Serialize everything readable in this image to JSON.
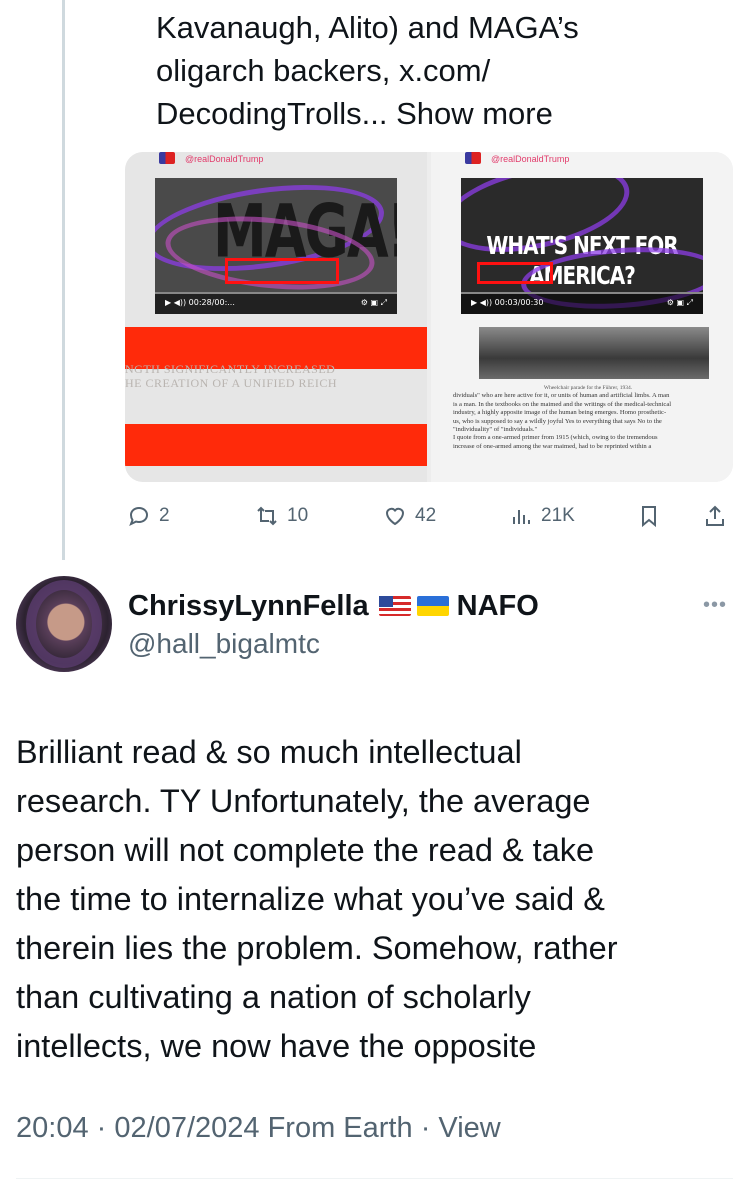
{
  "quoted_tweet": {
    "text_lines": [
      "Kavanaugh, Alito) and MAGA’s",
      "oligarch backers, x.com/",
      "DecodingTrolls..."
    ],
    "show_more": "Show more",
    "media": {
      "left": {
        "handle": "@realDonaldTrump",
        "headline": "MAGA!!",
        "video_time": "00:28/00:...",
        "caption_lines": [
          "NGTH SIGNIFICANTLY INCREASED",
          "HE CREATION OF A UNIFIED REICH"
        ]
      },
      "right": {
        "handle": "@realDonaldTrump",
        "headline": "WHAT'S NEXT FOR AMERICA?",
        "video_time": "00:03/00:30",
        "photo_caption": "Wheelchair parade for the Führer, 1934.",
        "book_lines": [
          "dividuals\" who are here active for it, or units of human and artificial limbs. A man",
          "is a man. In the textbooks on the maimed and the writings of the medical-technical",
          "industry, a highly apposite image of the human being emerges. Homo prosthetic-",
          "us, who is supposed to say a wildly joyful Yes to everything that says No to the",
          "\"individuality\" of \"individuals.\"",
          "I quote from a one-armed primer from 1915 (which, owing to the tremendous",
          "increase of one-armed among the war maimed, had to be reprinted within a"
        ]
      }
    },
    "actions": {
      "replies": "2",
      "reposts": "10",
      "likes": "42",
      "views": "21K"
    }
  },
  "reply": {
    "display_name": "ChrissyLynnFella",
    "name_suffix": "NAFO",
    "handle": "@hall_bigalmtc",
    "body": "Brilliant read & so much intellectual\nresearch.  TY Unfortunately, the average\nperson will not complete the read & take\nthe time to internalize what you’ve said &\ntherein lies the problem. Somehow, rather\nthan cultivating a nation of scholarly\nintellects, we now have the opposite",
    "time": "20:04",
    "date": "02/07/2024",
    "source": "From Earth",
    "view_link": "View",
    "separator": "·"
  },
  "colors": {
    "text_primary": "#0f1419",
    "text_secondary": "#536471",
    "thread_line": "#cfd9de",
    "highlight_red": "#ff2a0a",
    "scribble_purple": "#8c3ce6"
  },
  "icons": [
    "reply-icon",
    "repost-icon",
    "like-icon",
    "views-icon",
    "bookmark-icon",
    "share-icon",
    "more-icon"
  ]
}
